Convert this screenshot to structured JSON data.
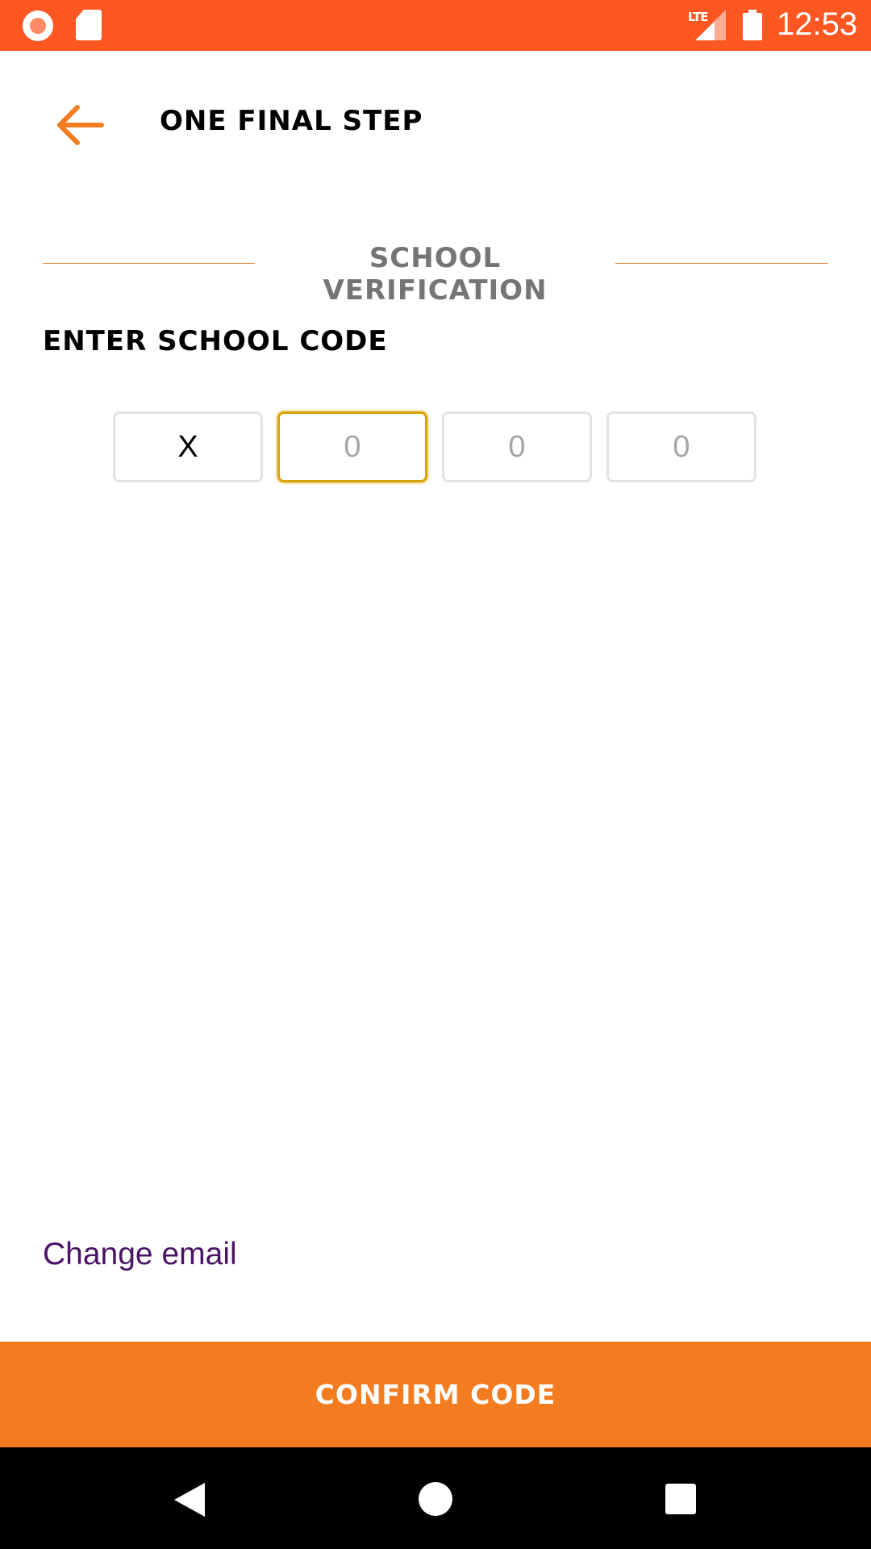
{
  "status_bar": {
    "time": "12:53",
    "network": "LTE",
    "background_color": "#ff5722",
    "icons": [
      "screen-record-icon",
      "sd-card-icon",
      "lte-signal-icon",
      "battery-icon"
    ]
  },
  "header": {
    "title": "ONE FINAL STEP",
    "back_icon": "arrow-left-icon",
    "accent_color": "#f37c20"
  },
  "section": {
    "title": "SCHOOL VERIFICATION"
  },
  "form": {
    "label": "ENTER SCHOOL CODE",
    "code_boxes": [
      {
        "value": "X",
        "placeholder": "0",
        "focused": false
      },
      {
        "value": "",
        "placeholder": "0",
        "focused": true
      },
      {
        "value": "",
        "placeholder": "0",
        "focused": false
      },
      {
        "value": "",
        "placeholder": "0",
        "focused": false
      }
    ]
  },
  "links": {
    "change_email": "Change email"
  },
  "actions": {
    "confirm_label": "CONFIRM CODE",
    "confirm_color": "#f37c20"
  },
  "nav_bar": {
    "icons": [
      "nav-back-icon",
      "nav-home-icon",
      "nav-recents-icon"
    ]
  }
}
